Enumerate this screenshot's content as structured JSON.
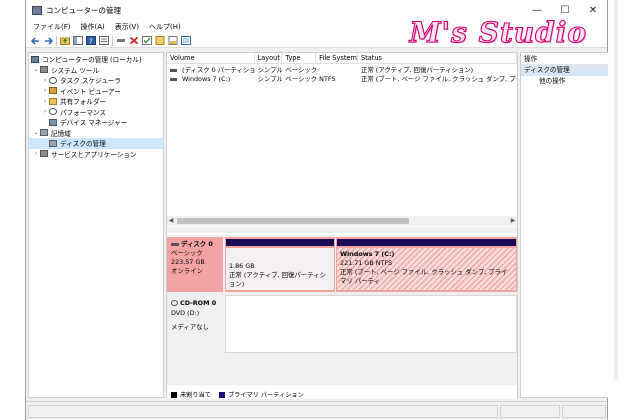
{
  "window": {
    "title": "コンピューターの管理",
    "controls": {
      "minimize": "—",
      "maximize": "☐",
      "close": "✕"
    }
  },
  "watermark": "M's Studio",
  "menu": [
    "ファイル(F)",
    "操作(A)",
    "表示(V)",
    "ヘルプ(H)"
  ],
  "toolbar": {
    "icons": [
      "back-arrow-icon",
      "forward-arrow-icon",
      "folder-up-icon",
      "console-tree-icon",
      "help-icon",
      "properties-icon",
      "connect-icon",
      "delete-icon",
      "check-icon",
      "rescan-icon",
      "export-icon",
      "view-icon"
    ]
  },
  "tree": {
    "items": [
      {
        "label": "コンピューターの管理 (ローカル)",
        "level": 0,
        "arrow": "",
        "icon": "computer-management-icon"
      },
      {
        "label": "システム ツール",
        "level": 1,
        "arrow": "⌄",
        "icon": "tools-icon"
      },
      {
        "label": "タスク スケジューラ",
        "level": 2,
        "arrow": "›",
        "icon": "task-scheduler-icon"
      },
      {
        "label": "イベント ビューアー",
        "level": 2,
        "arrow": "›",
        "icon": "event-viewer-icon"
      },
      {
        "label": "共有フォルダー",
        "level": 2,
        "arrow": "›",
        "icon": "shared-folder-icon"
      },
      {
        "label": "パフォーマンス",
        "level": 2,
        "arrow": "›",
        "icon": "performance-icon"
      },
      {
        "label": "デバイス マネージャー",
        "level": 2,
        "arrow": "",
        "icon": "device-manager-icon"
      },
      {
        "label": "記憶域",
        "level": 1,
        "arrow": "⌄",
        "icon": "storage-icon"
      },
      {
        "label": "ディスクの管理",
        "level": 2,
        "arrow": "",
        "icon": "disk-management-icon",
        "selected": true
      },
      {
        "label": "サービスとアプリケーション",
        "level": 1,
        "arrow": "›",
        "icon": "services-icon"
      }
    ]
  },
  "volumes": {
    "headers": [
      "Volume",
      "Layout",
      "Type",
      "File System",
      "Status"
    ],
    "rows": [
      {
        "volume": "(ディスク 0 パーティション 1)",
        "layout": "シンプル",
        "type": "ベーシック",
        "fs": "",
        "status": "正常 (アクティブ, 回復パーティション)"
      },
      {
        "volume": "Windows 7 (C:)",
        "layout": "シンプル",
        "type": "ベーシック",
        "fs": "NTFS",
        "status": "正常 (ブート, ページ ファイル, クラッシュ ダンプ, プライマリ パ"
      }
    ]
  },
  "disk0": {
    "name": "ディスク 0",
    "type": "ベーシック",
    "size": "223.57 GB",
    "state": "オンライン",
    "partitions": [
      {
        "name": "",
        "size": "1.86 GB",
        "status": "正常 (アクティブ, 回復パーティション)"
      },
      {
        "name": "Windows 7  (C:)",
        "size": "221.71 GB NTFS",
        "status": "正常 (ブート, ページ ファイル, クラッシュ ダンプ, プライマリ パーティ"
      }
    ]
  },
  "cdrom0": {
    "name": "CD-ROM 0",
    "drive": "DVD (D:)",
    "media": "メディアなし"
  },
  "legend": [
    {
      "label": "未割り当て",
      "color": "#000000"
    },
    {
      "label": "プライマリ パーティション",
      "color": "#1a0a8a"
    }
  ],
  "actions": {
    "header": "操作",
    "section": "ディスクの管理",
    "items": [
      {
        "label": "他の操作"
      }
    ]
  },
  "colors": {
    "selected_disk": "#f3a4a2",
    "partition_bar": "#1a0a57",
    "tree_selected": "#cce8ff",
    "actions_section": "#d8e6f4"
  }
}
